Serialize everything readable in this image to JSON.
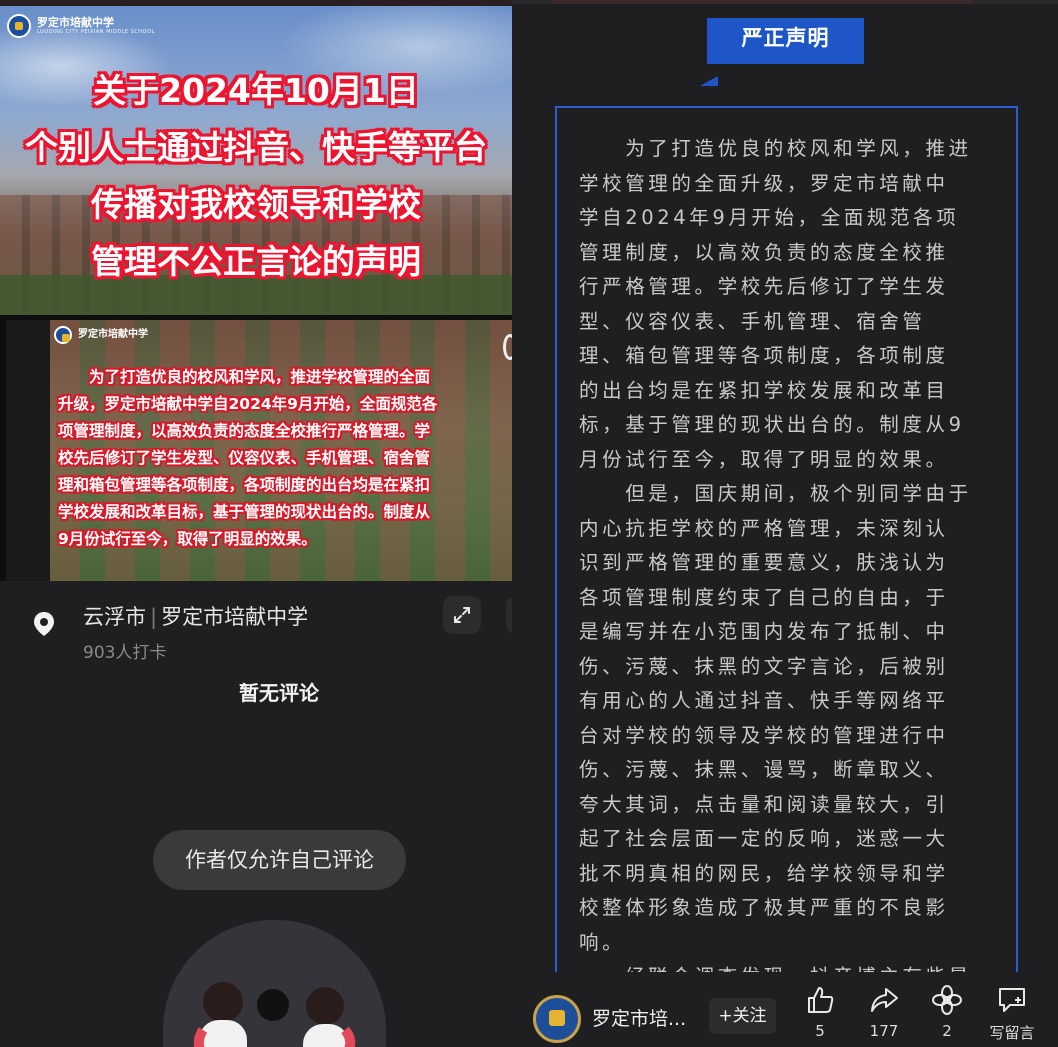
{
  "left": {
    "banner": {
      "logo_text": "罗定市培献中学",
      "logo_subtext": "LUODING CITY PEIXIAN MIDDLE SCHOOL",
      "lines": [
        "关于2024年10月1日",
        "个别人士通过抖音、快手等平台",
        "传播对我校领导和学校",
        "管理不公正言论的声明"
      ]
    },
    "card": {
      "logo_text": "罗定市培献中学",
      "lines": [
        "　　为了打造优良的校风和学风，推进学校管理的全面",
        "升级，罗定市培献中学自2024年9月开始，全面规范各",
        "项管理制度，以高效负责的态度全校推行严格管理。学",
        "校先后修订了学生发型、仪容仪表、手机管理、宿舍管",
        "理和箱包管理等各项制度，各项制度的出台均是在紧扣",
        "学校发展和改革目标，基于管理的现状出台的。制度从",
        "9月份试行至今，取得了明显的效果。"
      ]
    },
    "location": {
      "city": "云浮市",
      "place": "罗定市培献中学",
      "checkins": "903人打卡"
    },
    "no_comment": "暂无评论",
    "only_author": "作者仅允许自己评论"
  },
  "right": {
    "title": "严正声明",
    "article_lines": [
      "　　为了打造优良的校风和学风，推进",
      "学校管理的全面升级，罗定市培献中",
      "学自2024年9月开始，全面规范各项",
      "管理制度，以高效负责的态度全校推",
      "行严格管理。学校先后修订了学生发",
      "型、仪容仪表、手机管理、宿舍管",
      "理、箱包管理等各项制度，各项制度",
      "的出台均是在紧扣学校发展和改革目",
      "标，基于管理的现状出台的。制度从9",
      "月份试行至今，取得了明显的效果。",
      "　　但是，国庆期间，极个别同学由于",
      "内心抗拒学校的严格管理，未深刻认",
      "识到严格管理的重要意义，肤浅认为",
      "各项管理制度约束了自己的自由，于",
      "是编写并在小范围内发布了抵制、中",
      "伤、污蔑、抹黑的文字言论，后被别",
      "有用心的人通过抖音、快手等网络平",
      "台对学校的领导及学校的管理进行中",
      "伤、污蔑、抹黑、谩骂，断章取义、",
      "夸大其词，点击量和阅读量较大，引",
      "起了社会层面一定的反响，迷惑一大",
      "批不明真相的网民，给学校领导和学",
      "校整体形象造成了极其严重的不良影",
      "响。",
      "　　经联合调查发现，抖音博主有些是"
    ],
    "bottom": {
      "account_name": "罗定市培...",
      "follow": "+关注",
      "like_count": "5",
      "share_count": "177",
      "recommend_count": "2",
      "comment_label": "写留言"
    }
  },
  "colors": {
    "accent_blue": "#1e56c8",
    "banner_outline_red": "#e4162f"
  }
}
